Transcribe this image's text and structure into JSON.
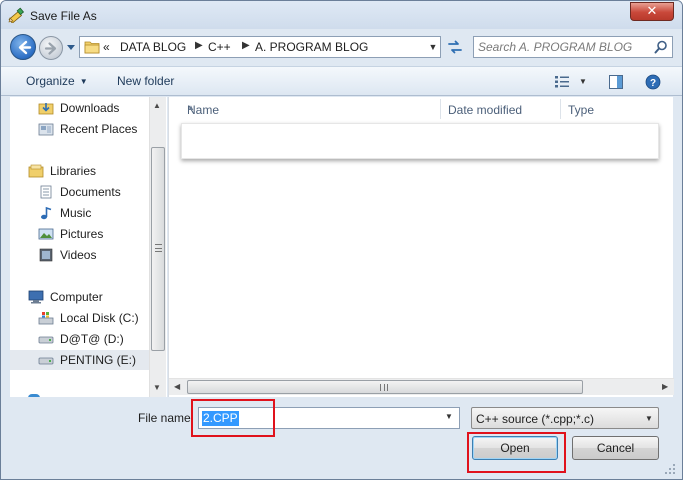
{
  "window": {
    "title": "Save File As"
  },
  "address": {
    "prefix": "«",
    "crumbs": [
      "DATA BLOG",
      "C++",
      "A. PROGRAM BLOG"
    ]
  },
  "search": {
    "placeholder": "Search A. PROGRAM BLOG"
  },
  "toolbar": {
    "organize_label": "Organize",
    "new_folder_label": "New folder"
  },
  "nav": {
    "items": [
      {
        "label": "Downloads"
      },
      {
        "label": "Recent Places"
      },
      {
        "label": "Libraries"
      },
      {
        "label": "Documents"
      },
      {
        "label": "Music"
      },
      {
        "label": "Pictures"
      },
      {
        "label": "Videos"
      },
      {
        "label": "Computer"
      },
      {
        "label": "Local Disk (C:)"
      },
      {
        "label": "D@T@ (D:)"
      },
      {
        "label": "PENTING (E:)"
      }
    ],
    "selected": "PENTING (E:)"
  },
  "file_list": {
    "columns": [
      "Name",
      "Date modified",
      "Type"
    ]
  },
  "save_form": {
    "file_name_label": "File name:",
    "file_name_value": "2.CPP",
    "file_type_value": "C++ source (*.cpp;*.c)"
  },
  "buttons": {
    "open_label": "Open",
    "cancel_label": "Cancel"
  },
  "colors": {
    "highlight_box": "#e0121c",
    "selection": "#3399ff"
  }
}
